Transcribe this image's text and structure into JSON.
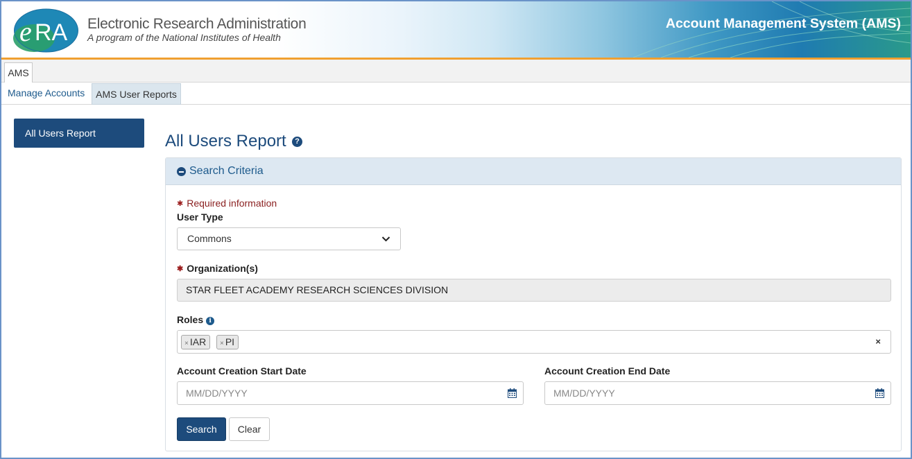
{
  "header": {
    "logo_text": "eRA",
    "brand_title": "Electronic Research Administration",
    "brand_subtitle": "A program of the National Institutes of Health",
    "app_title": "Account Management System (AMS)"
  },
  "tabs": {
    "primary": [
      {
        "label": "AMS",
        "active": true
      }
    ],
    "secondary": [
      {
        "label": "Manage Accounts",
        "active": false
      },
      {
        "label": "AMS User Reports",
        "active": true
      }
    ]
  },
  "sidebar": {
    "items": [
      {
        "label": "All Users Report",
        "active": true
      }
    ]
  },
  "main": {
    "page_title": "All Users Report",
    "help_icon": "question-circle-icon",
    "panel": {
      "title": "Search Criteria",
      "collapse_icon": "minus-circle-icon",
      "required_note": "Required information",
      "user_type": {
        "label": "User Type",
        "value": "Commons"
      },
      "organization": {
        "label": "Organization(s)",
        "value": "STAR FLEET ACADEMY RESEARCH SCIENCES DIVISION"
      },
      "roles": {
        "label": "Roles",
        "chips": [
          "IAR",
          "PI"
        ],
        "clear_label": "×"
      },
      "start_date": {
        "label": "Account Creation Start Date",
        "placeholder": "MM/DD/YYYY",
        "value": ""
      },
      "end_date": {
        "label": "Account Creation End Date",
        "placeholder": "MM/DD/YYYY",
        "value": ""
      },
      "search_button": "Search",
      "clear_button": "Clear"
    }
  },
  "colors": {
    "primary": "#1d4b7c",
    "accent_stripe": "#f0a030",
    "required": "#9b1c1c",
    "panel_header": "#dde8f2"
  }
}
